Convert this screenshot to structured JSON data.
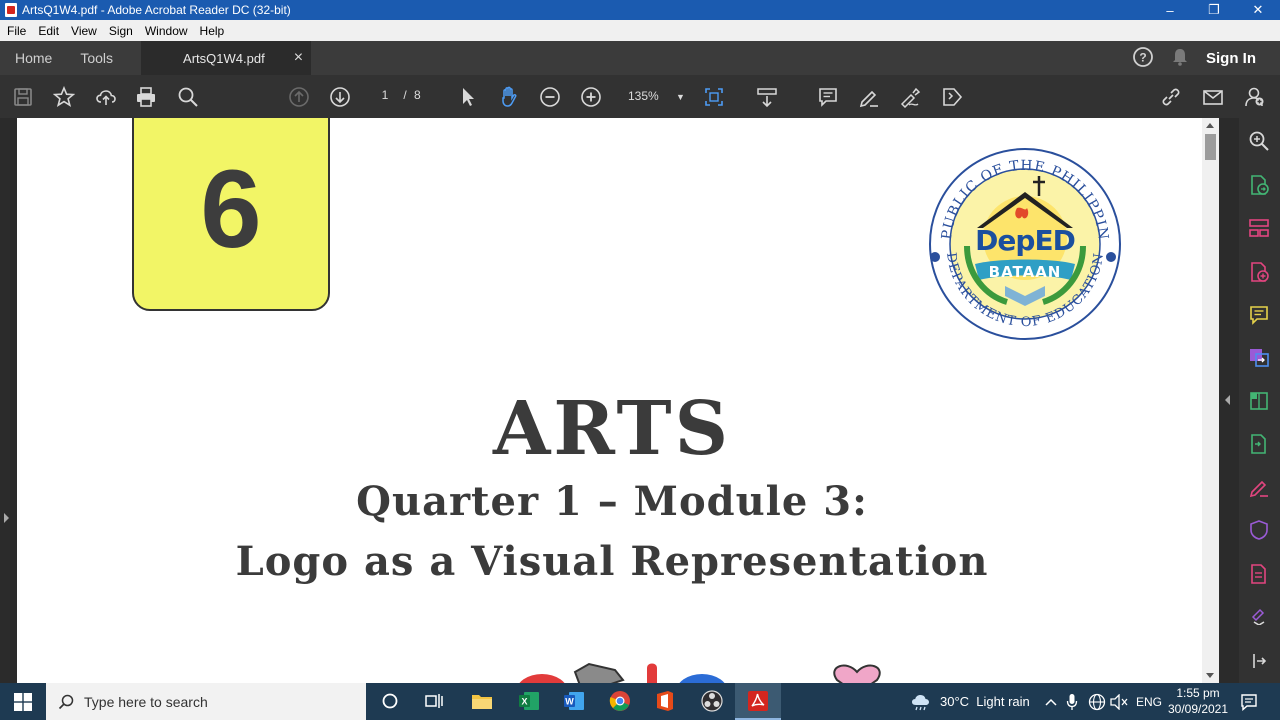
{
  "window": {
    "title": "ArtsQ1W4.pdf - Adobe Acrobat Reader DC (32-bit)",
    "minimize": "–",
    "maximize": "❐",
    "close": "✕"
  },
  "menu": [
    "File",
    "Edit",
    "View",
    "Sign",
    "Window",
    "Help"
  ],
  "tabs": {
    "home": "Home",
    "tools": "Tools",
    "document": "ArtsQ1W4.pdf",
    "close": "×",
    "signin": "Sign In"
  },
  "toolbar": {
    "current_page": "1",
    "page_sep": "/",
    "total_pages": "8",
    "zoom": "135%"
  },
  "document": {
    "grade": "6",
    "title": "ARTS",
    "subtitle1": "Quarter 1 – Module 3:",
    "subtitle2": "Logo as a Visual Representation",
    "seal": {
      "top_text": "REPUBLIC OF THE PHILIPPINES",
      "bottom_text": "DEPARTMENT OF EDUCATION",
      "logo": "DepED",
      "banner": "BATAAN"
    }
  },
  "taskbar": {
    "search_placeholder": "Type here to search",
    "weather": "30°C  Light rain",
    "language": "ENG",
    "time": "1:55 pm",
    "date": "30/09/2021"
  },
  "colors": {
    "titlebar": "#1b5bb0",
    "badge_yellow": "#f2f566",
    "acrobat_red": "#d4261f",
    "right_tool_accents": [
      "#4d8ff0",
      "#e2457f",
      "#e5d24a",
      "#9a5bd6",
      "#43b574"
    ]
  }
}
